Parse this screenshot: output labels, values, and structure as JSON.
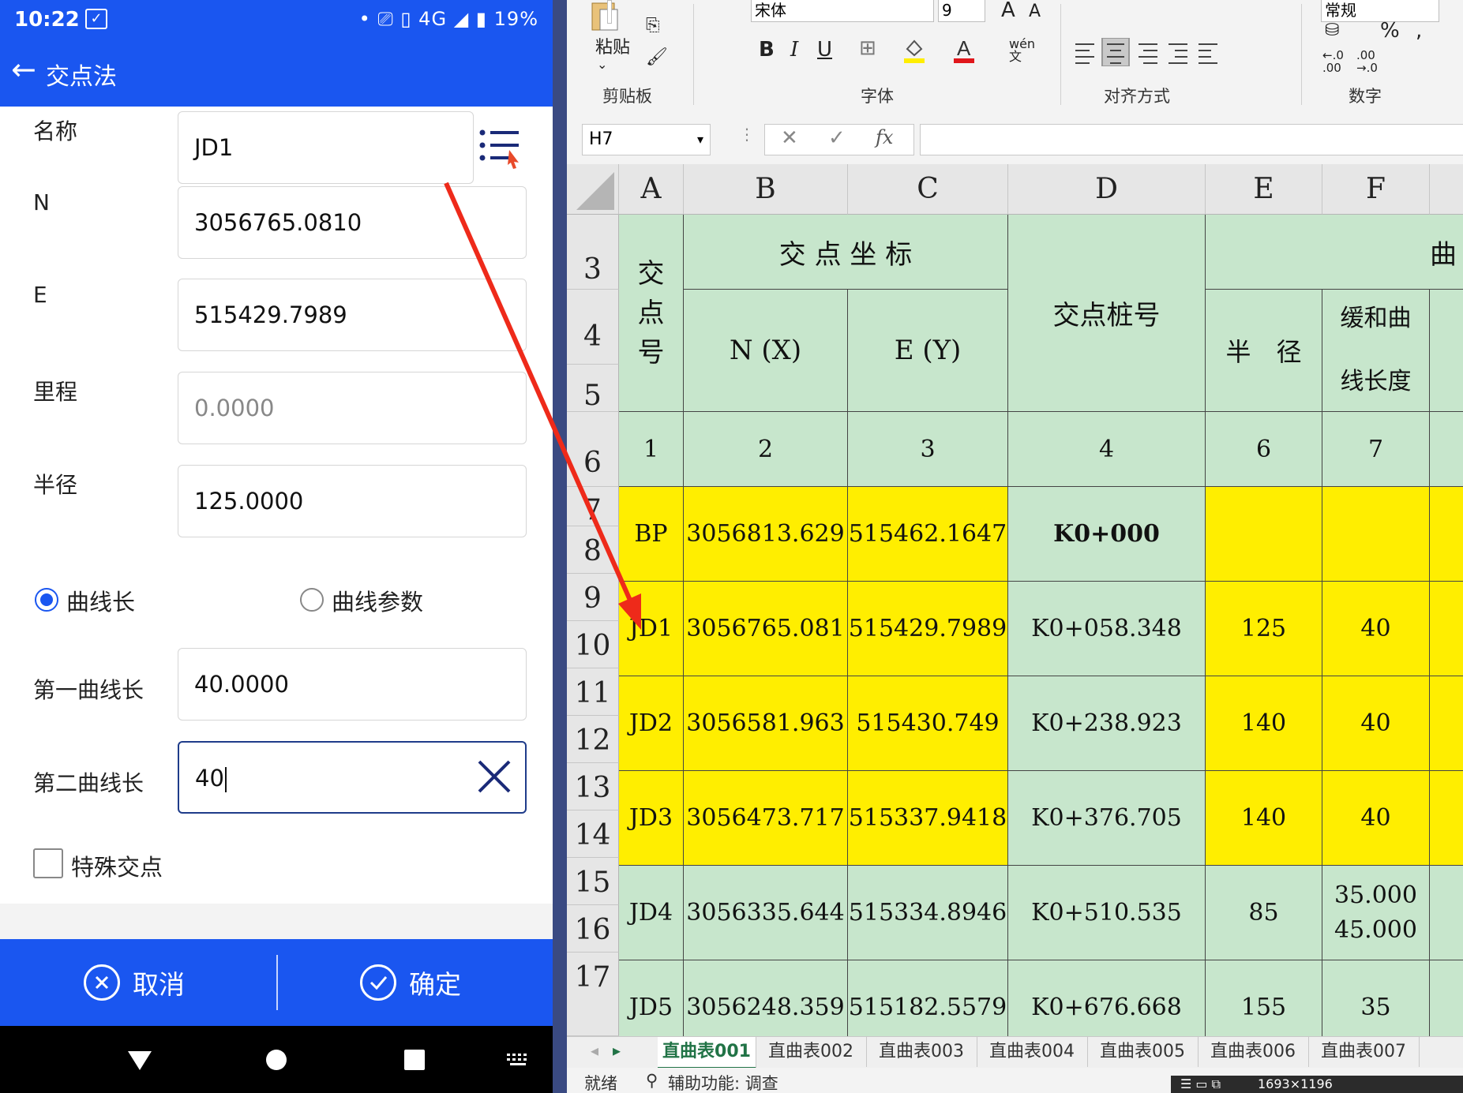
{
  "phone": {
    "status": {
      "time": "10:22",
      "network": "4G",
      "battery": "19%"
    },
    "title": "交点法",
    "fields": {
      "name_label": "名称",
      "name_value": "JD1",
      "n_label": "N",
      "n_value": "3056765.0810",
      "e_label": "E",
      "e_value": "515429.7989",
      "mileage_label": "里程",
      "mileage_value": "0.0000",
      "radius_label": "半径",
      "radius_value": "125.0000",
      "first_label": "第一曲线长",
      "first_value": "40.0000",
      "second_label": "第二曲线长",
      "second_value": "40"
    },
    "radio_curve_length": "曲线长",
    "radio_curve_param": "曲线参数",
    "checkbox_special": "特殊交点",
    "cancel": "取消",
    "confirm": "确定"
  },
  "excel": {
    "font": "宋体",
    "font_size": "9",
    "number_format": "常规",
    "groups": {
      "clipboard": "剪贴板",
      "font": "字体",
      "align": "对齐方式",
      "number": "数字"
    },
    "paste": "粘贴",
    "pinyin": "wén",
    "namebox": "H7",
    "columns": [
      "A",
      "B",
      "C",
      "D",
      "E",
      "F"
    ],
    "rows": [
      "3",
      "4",
      "5",
      "6",
      "7",
      "8",
      "9",
      "10",
      "11",
      "12",
      "13",
      "14",
      "15",
      "16",
      "17"
    ],
    "header": {
      "jd_no": "交点号",
      "coord": "交 点 坐 标",
      "nx": "N (X)",
      "ey": "E (Y)",
      "station": "交点桩号",
      "radius": "半　径",
      "curve_group": "曲",
      "trans1": "缓和曲",
      "trans2": "线长度",
      "idx": [
        "1",
        "2",
        "3",
        "4",
        "6",
        "7"
      ]
    },
    "data": [
      {
        "jd": "BP",
        "n": "3056813.629",
        "e": "515462.1647",
        "st": "K0+000",
        "r": "",
        "ls": ""
      },
      {
        "jd": "JD1",
        "n": "3056765.081",
        "e": "515429.7989",
        "st": "K0+058.348",
        "r": "125",
        "ls": "40"
      },
      {
        "jd": "JD2",
        "n": "3056581.963",
        "e": "515430.749",
        "st": "K0+238.923",
        "r": "140",
        "ls": "40"
      },
      {
        "jd": "JD3",
        "n": "3056473.717",
        "e": "515337.9418",
        "st": "K0+376.705",
        "r": "140",
        "ls": "40"
      },
      {
        "jd": "JD4",
        "n": "3056335.644",
        "e": "515334.8946",
        "st": "K0+510.535",
        "r": "85",
        "ls": "35.000",
        "ls2": "45.000"
      },
      {
        "jd": "JD5",
        "n": "3056248.359",
        "e": "515182.5579",
        "st": "K0+676.668",
        "r": "155",
        "ls": "35"
      }
    ],
    "sheets": [
      "直曲表001",
      "直曲表002",
      "直曲表003",
      "直曲表004",
      "直曲表005",
      "直曲表006",
      "直曲表007"
    ],
    "status_ready": "就绪",
    "status_access": "辅助功能: 调查",
    "size_label": "1693×1196"
  }
}
